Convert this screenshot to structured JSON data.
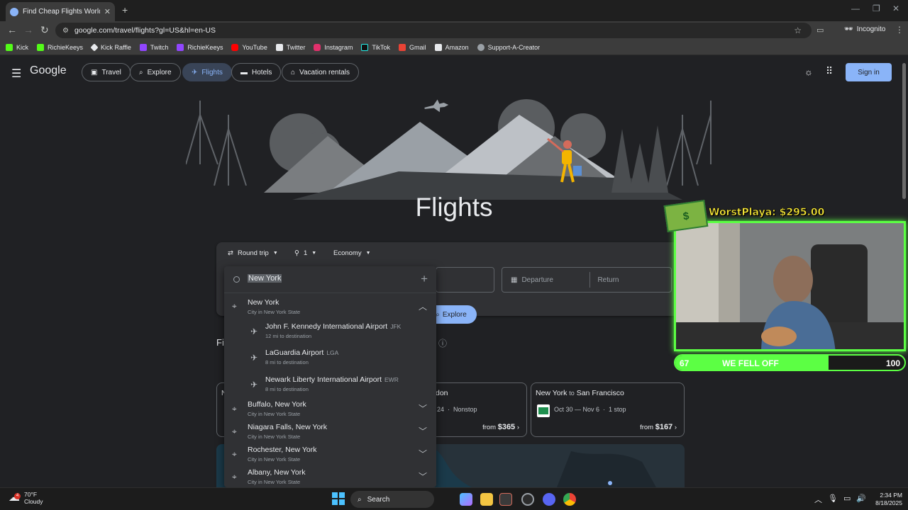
{
  "browser": {
    "tab_title": "Find Cheap Flights Worldwide &",
    "url": "google.com/travel/flights?gl=US&hl=en-US",
    "incognito_label": "Incognito",
    "bookmarks": [
      "Kick",
      "RichieKeeys",
      "Kick Raffle",
      "Twitch",
      "RichieKeeys",
      "YouTube",
      "Twitter",
      "Instagram",
      "TikTok",
      "Gmail",
      "Amazon",
      "Support-A-Creator"
    ]
  },
  "header": {
    "logo": "Google",
    "nav": [
      "Travel",
      "Explore",
      "Flights",
      "Hotels",
      "Vacation rentals"
    ],
    "active_nav": "Flights",
    "signin_label": "Sign in"
  },
  "page_title": "Flights",
  "search": {
    "trip_type": "Round trip",
    "passengers": "1",
    "cabin": "Economy",
    "departure_placeholder": "Departure",
    "return_placeholder": "Return",
    "explore_label": "Explore"
  },
  "dropdown": {
    "input_value": "New York",
    "items": [
      {
        "name": "New York",
        "sub": "City in New York State",
        "expanded": true
      },
      {
        "name": "John F. Kennedy International Airport",
        "code": "JFK",
        "sub": "12 mi to destination"
      },
      {
        "name": "LaGuardia Airport",
        "code": "LGA",
        "sub": "8 mi to destination"
      },
      {
        "name": "Newark Liberty International Airport",
        "code": "EWR",
        "sub": "8 mi to destination"
      },
      {
        "name": "Buffalo, New York",
        "sub": "City in New York State"
      },
      {
        "name": "Niagara Falls, New York",
        "sub": "City in New York State"
      },
      {
        "name": "Rochester, New York",
        "sub": "City in New York State"
      },
      {
        "name": "Albany, New York",
        "sub": "City in New York State"
      }
    ]
  },
  "cards": [
    {
      "partial_route": "N",
      "partial_heading": "Fi"
    },
    {
      "route_tail": "don",
      "dates": "24",
      "stops": "Nonstop",
      "from": "from",
      "price": "$365"
    },
    {
      "origin": "New York",
      "to": "to",
      "dest": "San Francisco",
      "dates": "Oct 30 — Nov 6",
      "stops": "1 stop",
      "from": "from",
      "price": "$167"
    }
  ],
  "overlay": {
    "donation": "WorstPlaya: $295.00",
    "bill_symbol": "$",
    "goal_current": "67",
    "goal_label": "WE FELL OFF",
    "goal_max": "100",
    "goal_fraction": 0.67
  },
  "taskbar": {
    "temp": "70°F",
    "condition": "Cloudy",
    "search_label": "Search",
    "time": "2:34 PM",
    "date": "8/18/2025",
    "weather_badge": "4"
  },
  "colors": {
    "accent": "#8ab4f8",
    "overlay_green": "#5cff44",
    "donation_yellow": "#f5e637"
  }
}
